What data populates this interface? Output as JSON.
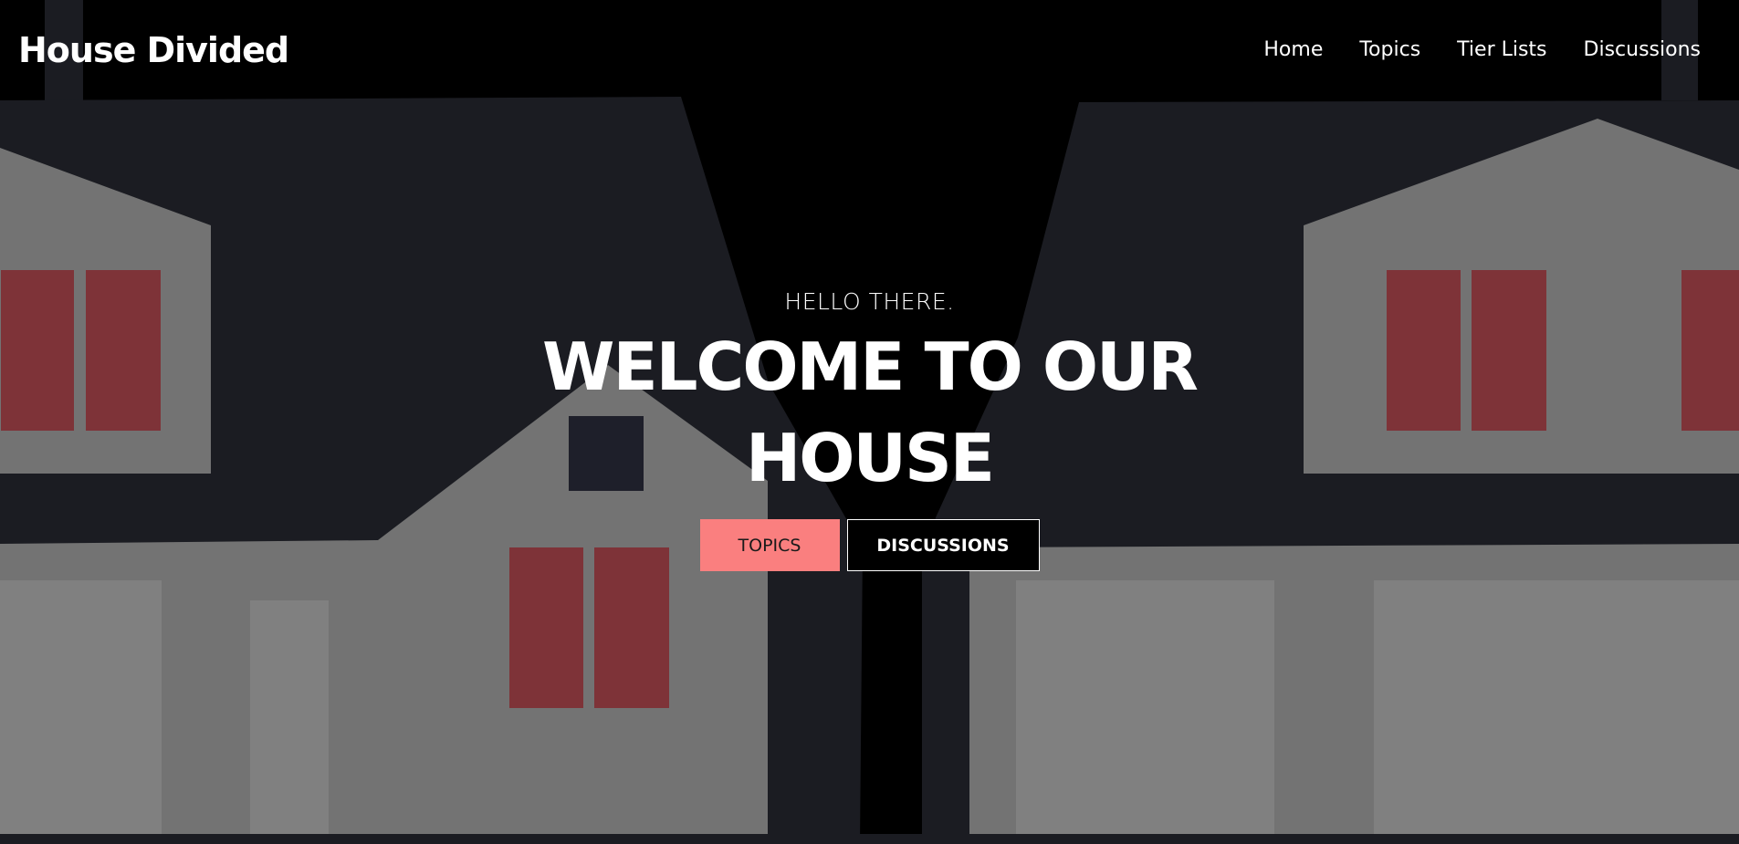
{
  "brand": {
    "name": "House Divided"
  },
  "nav": {
    "items": [
      {
        "label": "Home"
      },
      {
        "label": "Topics"
      },
      {
        "label": "Tier Lists"
      },
      {
        "label": "Discussions"
      }
    ]
  },
  "hero": {
    "eyebrow": "HELLO THERE.",
    "title": "WELCOME TO OUR HOUSE",
    "buttons": {
      "topics": "TOPICS",
      "discussions": "DISCUSSIONS"
    }
  },
  "colors": {
    "background": "#000000",
    "house_dark": "#1b1c22",
    "house_gray": "#737373",
    "house_light_gray": "#808080",
    "window_red": "#7e3338",
    "accent_salmon": "#fa7f7f",
    "text": "#ffffff"
  }
}
